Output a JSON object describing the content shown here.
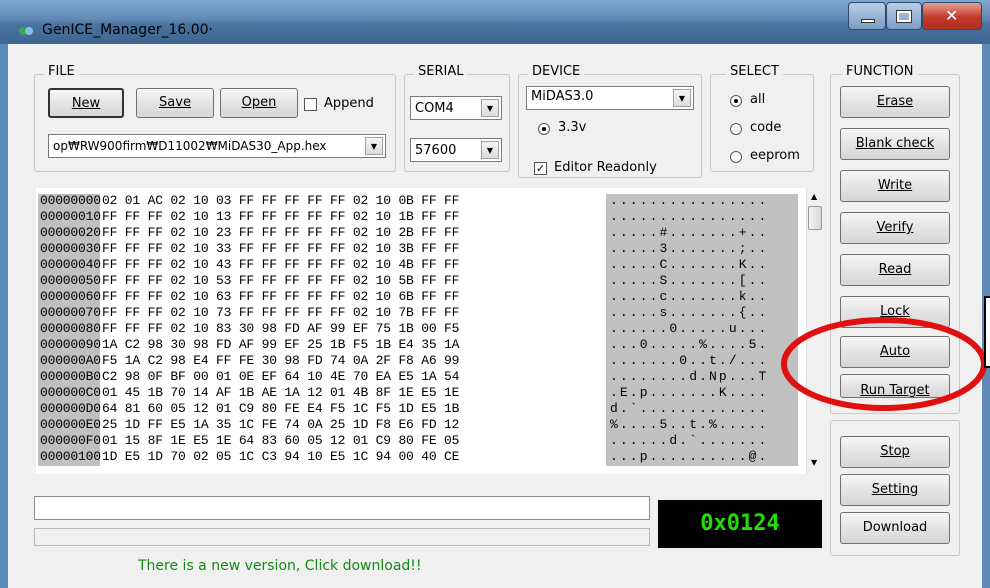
{
  "window": {
    "title": "GenICE_Manager_16.00·"
  },
  "file": {
    "legend": "FILE",
    "new_label": "New",
    "save_label": "Save",
    "open_label": "Open",
    "append_label": "Append",
    "path_value": "op₩RW900firm₩D11002₩MiDAS30_App.hex"
  },
  "serial": {
    "legend": "SERIAL",
    "port_value": "COM4",
    "baud_value": "57600"
  },
  "device": {
    "legend": "DEVICE",
    "device_value": "MiDAS3.0",
    "voltage_label": "3.3v",
    "editor_readonly_label": "Editor Readonly"
  },
  "select": {
    "legend": "SELECT",
    "options": [
      "all",
      "code",
      "eeprom"
    ],
    "selected": "all"
  },
  "function": {
    "legend": "FUNCTION",
    "buttons": [
      "Erase",
      "Blank check",
      "Write",
      "Verify",
      "Read",
      "Lock",
      "Auto",
      "Run Target"
    ],
    "lower_buttons": [
      "Stop",
      "Setting",
      "Download"
    ]
  },
  "hex": {
    "rows": [
      {
        "addr": "00000000",
        "bytes": "02 01 AC 02 10 03 FF FF FF FF FF 02 10 0B FF FF",
        "ascii": "................"
      },
      {
        "addr": "00000010",
        "bytes": "FF FF FF 02 10 13 FF FF FF FF FF 02 10 1B FF FF",
        "ascii": "................"
      },
      {
        "addr": "00000020",
        "bytes": "FF FF FF 02 10 23 FF FF FF FF FF 02 10 2B FF FF",
        "ascii": ".....#.......+.."
      },
      {
        "addr": "00000030",
        "bytes": "FF FF FF 02 10 33 FF FF FF FF FF 02 10 3B FF FF",
        "ascii": ".....3.......;.."
      },
      {
        "addr": "00000040",
        "bytes": "FF FF FF 02 10 43 FF FF FF FF FF 02 10 4B FF FF",
        "ascii": ".....C.......K.."
      },
      {
        "addr": "00000050",
        "bytes": "FF FF FF 02 10 53 FF FF FF FF FF 02 10 5B FF FF",
        "ascii": ".....S.......[.."
      },
      {
        "addr": "00000060",
        "bytes": "FF FF FF 02 10 63 FF FF FF FF FF 02 10 6B FF FF",
        "ascii": ".....c.......k.."
      },
      {
        "addr": "00000070",
        "bytes": "FF FF FF 02 10 73 FF FF FF FF FF 02 10 7B FF FF",
        "ascii": ".....s.......{.."
      },
      {
        "addr": "00000080",
        "bytes": "FF FF FF 02 10 83 30 98 FD AF 99 EF 75 1B 00 F5",
        "ascii": "......0.....u..."
      },
      {
        "addr": "00000090",
        "bytes": "1A C2 98 30 98 FD AF 99 EF 25 1B F5 1B E4 35 1A",
        "ascii": "...0.....%....5."
      },
      {
        "addr": "000000A0",
        "bytes": "F5 1A C2 98 E4 FF FE 30 98 FD 74 0A 2F F8 A6 99",
        "ascii": ".......0..t./..."
      },
      {
        "addr": "000000B0",
        "bytes": "C2 98 0F BF 00 01 0E EF 64 10 4E 70 EA E5 1A 54",
        "ascii": "........d.Np...T"
      },
      {
        "addr": "000000C0",
        "bytes": "01 45 1B 70 14 AF 1B AE 1A 12 01 4B 8F 1E E5 1E",
        "ascii": ".E.p.......K...."
      },
      {
        "addr": "000000D0",
        "bytes": "64 81 60 05 12 01 C9 80 FE E4 F5 1C F5 1D E5 1B",
        "ascii": "d.`............."
      },
      {
        "addr": "000000E0",
        "bytes": "25 1D FF E5 1A 35 1C FE 74 0A 25 1D F8 E6 FD 12",
        "ascii": "%....5..t.%....."
      },
      {
        "addr": "000000F0",
        "bytes": "01 15 8F 1E E5 1E 64 83 60 05 12 01 C9 80 FE 05",
        "ascii": "......d.`......."
      },
      {
        "addr": "00000100",
        "bytes": "1D E5 1D 70 02 05 1C C3 94 10 E5 1C 94 00 40 CE",
        "ascii": "...p..........@."
      }
    ]
  },
  "status": {
    "address_display": "0x0124",
    "notice": "There is a new version, Click download!!"
  },
  "colors": {
    "highlight_circle": "#e01010",
    "display_text": "#1fe000",
    "notice_text": "#138a13"
  }
}
